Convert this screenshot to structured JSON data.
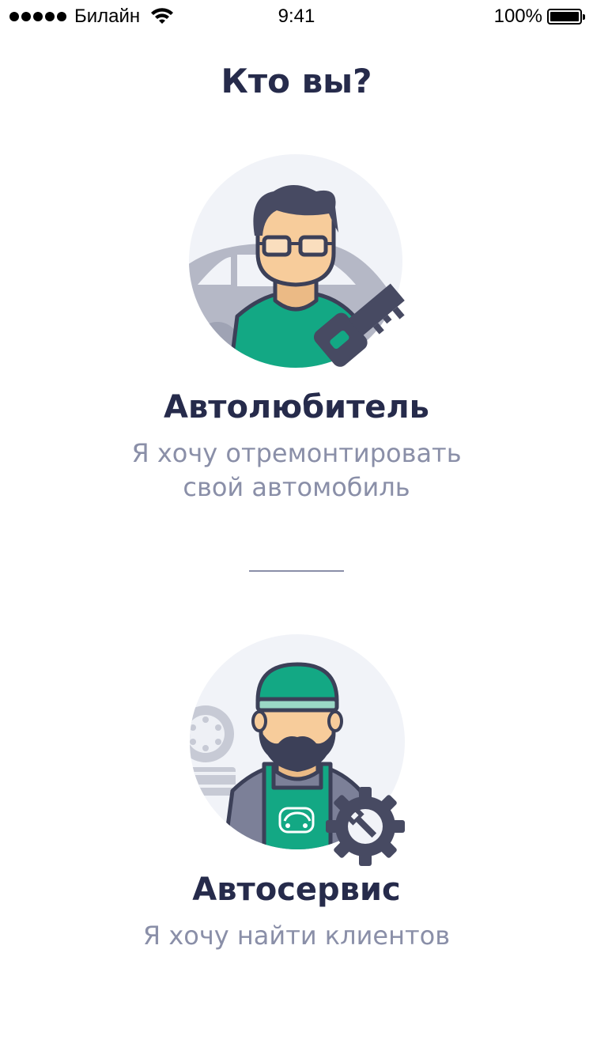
{
  "status_bar": {
    "carrier": "Билайн",
    "time": "9:41",
    "battery": "100%"
  },
  "page": {
    "title": "Кто вы?"
  },
  "roles": [
    {
      "title": "Автолюбитель",
      "description_line1": "Я хочу отремонтировать",
      "description_line2": "свой автомобиль"
    },
    {
      "title": "Автосервис",
      "description": "Я хочу найти клиентов"
    }
  ],
  "colors": {
    "title": "#262b4b",
    "subtitle": "#8a8fa8",
    "accent_green": "#13a884",
    "circle_bg": "#f1f3f8",
    "dark_outline": "#3c4058"
  }
}
